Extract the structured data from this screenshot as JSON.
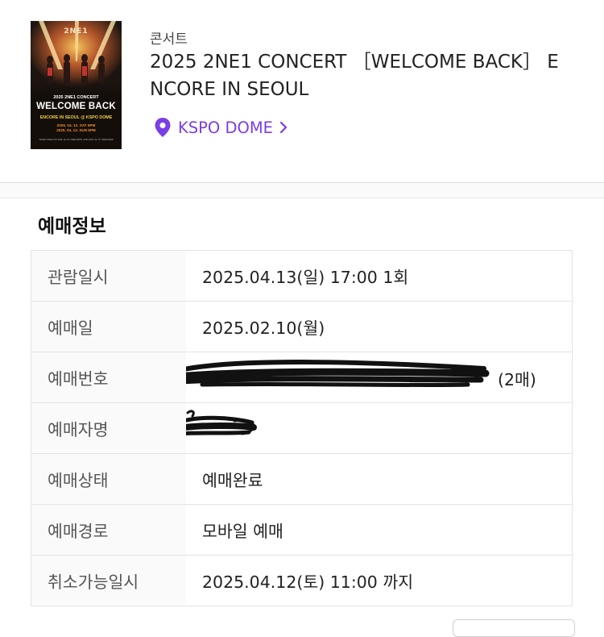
{
  "event": {
    "category": "콘서트",
    "title": "2025 2NE1 CONCERT ［WELCOME BACK］ ENCORE IN SEOUL",
    "venue": "KSPO DOME",
    "poster": {
      "logo": "2NE1",
      "subtitle": "2025 2NE1 CONCERT",
      "title": "WELCOME BACK",
      "encore": "ENCORE IN SEOUL @ KSPO DOME",
      "date1": "2025. 04. 12. SAT 5PM",
      "date2": "2025. 04. 13. SUN 5PM",
      "fine_print": "TICKET OPEN 1ST 2025. 02. 06 / NEW APPN / 2ND 2025. 02. 07 / WEB OPEN"
    }
  },
  "booking": {
    "section_title": "예매정보",
    "rows": [
      {
        "label": "관람일시",
        "value": "2025.04.13(일) 17:00 1회"
      },
      {
        "label": "예매일",
        "value": "2025.02.10(월)"
      },
      {
        "label": "예매번호",
        "value": "",
        "suffix": "(2매)"
      },
      {
        "label": "예매자명",
        "value": ""
      },
      {
        "label": "예매상태",
        "value": "예매완료"
      },
      {
        "label": "예매경로",
        "value": "모바일 예매"
      },
      {
        "label": "취소가능일시",
        "value": "2025.04.12(토) 11:00 까지"
      }
    ]
  },
  "colors": {
    "accent": "#7a3ee6",
    "label_bg": "#fafafa",
    "border": "#e3e3e3"
  },
  "icons": {
    "venue_pin": "map-pin-icon",
    "venue_arrow": "chevron-right-icon"
  }
}
